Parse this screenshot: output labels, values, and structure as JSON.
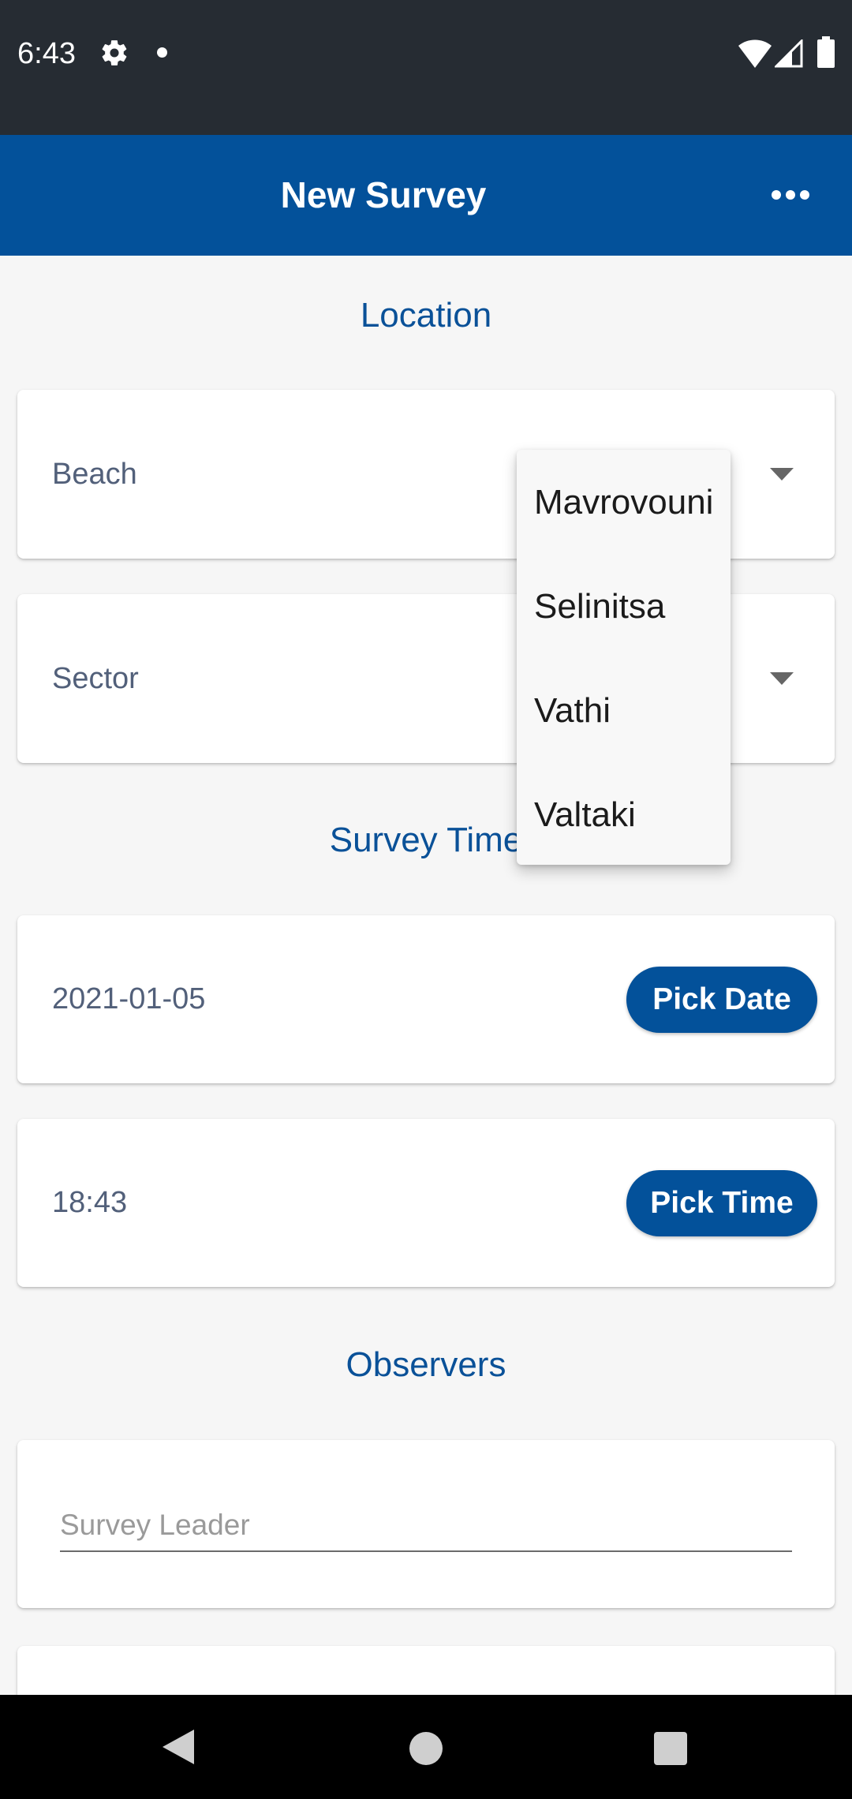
{
  "status_bar": {
    "time": "6:43",
    "icons": [
      "gear-icon",
      "notification-dot-icon",
      "wifi-icon",
      "signal-icon",
      "battery-icon"
    ]
  },
  "app_bar": {
    "title": "New Survey",
    "menu_icon": "more-horizontal-icon",
    "background": "#03519a"
  },
  "location": {
    "heading": "Location",
    "beach_label": "Beach",
    "sector_label": "Sector"
  },
  "dropdown": {
    "options": [
      "Mavrovouni",
      "Selinitsa",
      "Vathi",
      "Valtaki"
    ]
  },
  "survey_time": {
    "heading": "Survey Time",
    "date_value": "2021-01-05",
    "pick_date_label": "Pick Date",
    "time_value": "18:43",
    "pick_time_label": "Pick Time"
  },
  "observers": {
    "heading": "Observers",
    "leader_placeholder": "Survey Leader"
  },
  "colors": {
    "accent": "#03519a",
    "heading": "#0a5198",
    "status_bar": "#262c33"
  }
}
